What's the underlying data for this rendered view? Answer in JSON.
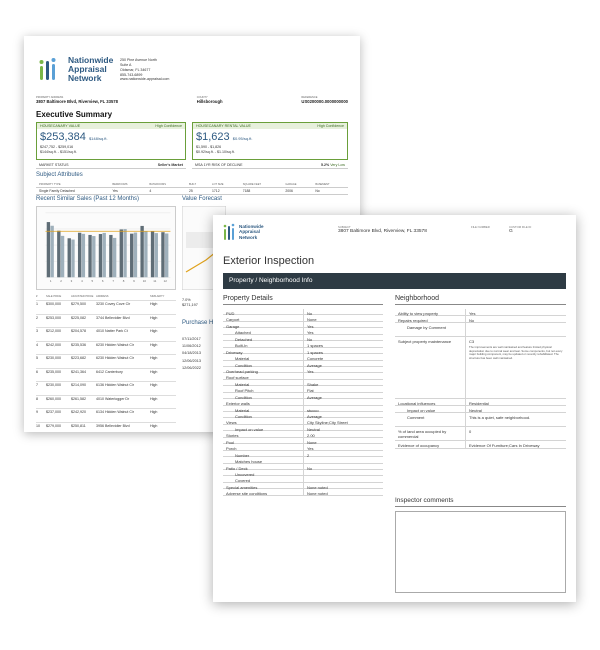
{
  "back_page": {
    "logo_text": [
      "Nationwide",
      "Appraisal",
      "Network"
    ],
    "company_address": [
      "250 Pine Avenue North",
      "Suite A",
      "Oldsmar, FL 34677",
      "855-743-6899",
      "www.nationwide-appraisal.com"
    ],
    "property_address_label": "Property Address",
    "property_address": "3807 Baltimore Blvd, Riverview, FL 33578",
    "county_label": "County",
    "county": "Hillsborough",
    "file_no_label": "Reference",
    "file_no": "US0200000.0000000000",
    "title": "Executive Summary",
    "value_box": {
      "header": "HOUSECANARY VALUE",
      "confidence": "High Confidence",
      "value": "$253,384",
      "per_sqft": "$148/sq.ft.",
      "range": "$247,752 - $259,016",
      "range_sqft": "$144/sq.ft. - $151/sq.ft."
    },
    "rental_box": {
      "header": "HOUSECANARY RENTAL VALUE",
      "confidence": "High Confidence",
      "value": "$1,623",
      "per_sqft": "$0.95/sq.ft.",
      "range": "$1,590 - $1,826",
      "range_sqft": "$0.92/sq.ft. - $1.10/sq.ft."
    },
    "market_status_label": "MARKET STATUS",
    "market_status": "Seller's Market",
    "decline_label": "MSA 1YR RISK OF DECLINE",
    "decline_value": "5.2%",
    "decline_text": "Very Low",
    "subject_title": "Subject Attributes",
    "subject_headers": [
      "PROPERTY TYPE",
      "BEDROOMS",
      "BATHROOMS",
      "BUILT",
      "LOT SIZE",
      "SQUARE FEET",
      "GARAGE",
      "BASEMENT"
    ],
    "subject_values": [
      "Single Family Detached",
      "Yes",
      "4",
      "25",
      "1712",
      "7188",
      "2006",
      "No"
    ],
    "sales_title": "Recent Similar Sales (Past 12 Months)",
    "forecast_title": "Value Forecast",
    "forecast_values": [
      "7.0%",
      "$271,197"
    ],
    "purchase_title": "Purchase His",
    "purchase_dates": [
      "07/11/2017",
      "11/06/2012",
      "04/18/2013",
      "12/06/2013",
      "12/06/2022"
    ],
    "sales_headers": [
      "#",
      "SALE PRICE",
      "ADJUSTED PRICE",
      "ADDRESS",
      "SIMILARITY"
    ],
    "sales_rows": [
      [
        "1",
        "$300,000",
        "$279,500",
        "3230 Covey Cove Cir",
        "High"
      ],
      [
        "2",
        "$253,000",
        "$225,082",
        "3744 Bellevidier Blvd",
        "High"
      ],
      [
        "3",
        "$212,000",
        "$204,578",
        "4010 Natter Park Ct",
        "High"
      ],
      [
        "4",
        "$242,000",
        "$235,536",
        "6230 Hidden Walnut Cir",
        "High"
      ],
      [
        "5",
        "$230,000",
        "$223,682",
        "6230 Hidden Walnut Cir",
        "High"
      ],
      [
        "6",
        "$235,000",
        "$241,364",
        "6412 Canterbury",
        "High"
      ],
      [
        "7",
        "$230,000",
        "$214,090",
        "6136 Hidden Walnut Cir",
        "High"
      ],
      [
        "8",
        "$260,000",
        "$261,582",
        "4010 Waterlogger Dr",
        "High"
      ],
      [
        "9",
        "$237,000",
        "$242,920",
        "6134 Hidden Walnut Cir",
        "High"
      ],
      [
        "10",
        "$279,000",
        "$250,811",
        "3956 Bellevidier Blvd",
        "High"
      ]
    ]
  },
  "front_page": {
    "logo_text": [
      "Nationwide",
      "Appraisal",
      "Network"
    ],
    "subject_label": "Subject",
    "subject_value": "3807 Baltimore Blvd, Riverview, FL 33578",
    "file_label": "File Number",
    "custom_label": "Custom File ID",
    "custom_value": "G",
    "title": "Exterior Inspection",
    "banner": "Property / Neighborhood Info",
    "property_title": "Property Details",
    "neighborhood_title": "Neighborhood",
    "property_rows": [
      {
        "k": "PUD",
        "v": "No",
        "sub": false
      },
      {
        "k": "Carport",
        "v": "None",
        "sub": false
      },
      {
        "k": "Garage",
        "v": "Yes",
        "sub": false
      },
      {
        "k": "Attached",
        "v": "Yes",
        "sub": true
      },
      {
        "k": "Detached",
        "v": "No",
        "sub": true
      },
      {
        "k": "Built-In",
        "v": "1 spaces",
        "sub": true
      },
      {
        "k": "Driveway",
        "v": "1 spaces",
        "sub": false
      },
      {
        "k": "Material",
        "v": "Concrete",
        "sub": true
      },
      {
        "k": "Condition",
        "v": "Average",
        "sub": true
      },
      {
        "k": "Overhead parking",
        "v": "Yes",
        "sub": false
      },
      {
        "k": "Roof surface",
        "v": "",
        "sub": false
      },
      {
        "k": "Material",
        "v": "Shake",
        "sub": true
      },
      {
        "k": "Roof Pitch",
        "v": "Flat",
        "sub": true
      },
      {
        "k": "Condition",
        "v": "Average",
        "sub": true
      },
      {
        "k": "Exterior walls",
        "v": "",
        "sub": false
      },
      {
        "k": "Material",
        "v": "stucco",
        "sub": true
      },
      {
        "k": "Condition",
        "v": "Average",
        "sub": true
      },
      {
        "k": "Views",
        "v": "City Skyline;City Street",
        "sub": false
      },
      {
        "k": "Impact on value",
        "v": "Neutral",
        "sub": true
      },
      {
        "k": "Stories",
        "v": "2.00",
        "sub": false
      },
      {
        "k": "Pool",
        "v": "None",
        "sub": false
      },
      {
        "k": "Porch",
        "v": "Yes",
        "sub": false
      },
      {
        "k": "Number",
        "v": "2",
        "sub": true
      },
      {
        "k": "Matches house",
        "v": "",
        "sub": true
      },
      {
        "k": "Patio / Deck",
        "v": "No",
        "sub": false
      },
      {
        "k": "Uncovered",
        "v": "",
        "sub": true
      },
      {
        "k": "Covered",
        "v": "",
        "sub": true
      },
      {
        "k": "Special amenities",
        "v": "None noted",
        "sub": false
      },
      {
        "k": "Adverse site conditions",
        "v": "None noted",
        "sub": false
      }
    ],
    "neighborhood_rows": [
      {
        "k": "Ability to view property",
        "v": "Yes"
      },
      {
        "k": "Repairs required",
        "v": "No"
      },
      {
        "k": "Damage by Comment",
        "v": ""
      },
      {
        "k": "Subject property maintenance",
        "v": "C3"
      },
      {
        "k": "Locational influences",
        "v": "Residential"
      },
      {
        "k": "Impact on value",
        "v": "Neutral"
      },
      {
        "k": "Comment",
        "v": "This is a quiet, safe neighborhood."
      },
      {
        "k": "% of land area occupied by commercial",
        "v": "0"
      },
      {
        "k": "Evidence of occupancy",
        "v": "Evidence Of Furniture;Cars In Driveway"
      }
    ],
    "maintenance_comment": "The improvements are well maintained and feature limited physical depreciation due to normal wear and tear. Some components, but not every major building component, may be updated or recently rehabilitated. The structure has been well maintained.",
    "comments_title": "Inspector comments"
  },
  "chart_data": {
    "type": "bar",
    "title": "Recent Similar Sales (Past 12 Months)",
    "categories": [
      "1",
      "2",
      "3",
      "4",
      "5",
      "6",
      "7",
      "8",
      "9",
      "10",
      "11",
      "12"
    ],
    "series": [
      {
        "name": "",
        "values": [
          300,
          253,
          212,
          242,
          230,
          235,
          230,
          260,
          237,
          279,
          250,
          245
        ],
        "color": "#5f6d76"
      },
      {
        "name": "",
        "values": [
          280,
          225,
          205,
          236,
          224,
          241,
          214,
          262,
          243,
          251,
          240,
          238
        ],
        "color": "#9fb0bb"
      }
    ],
    "avg_line": 250,
    "ylim": [
      0,
      350
    ]
  }
}
